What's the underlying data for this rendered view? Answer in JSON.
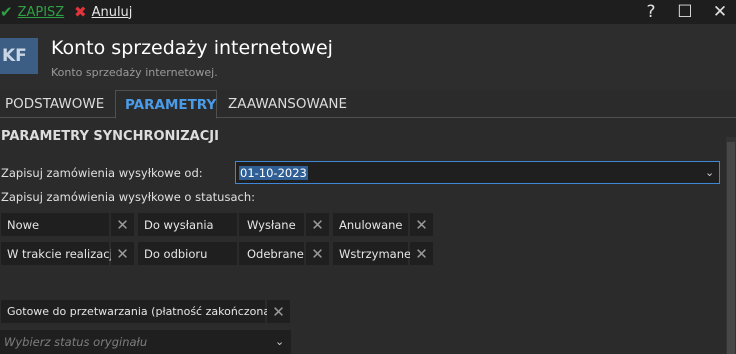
{
  "toolbar": {
    "save_label": "ZAPISZ",
    "cancel_label": "Anuluj",
    "save_color": "#2ea043",
    "cancel_color": "#e0343a",
    "help_glyph": "?",
    "maximize_glyph": "☐",
    "close_glyph": "✕"
  },
  "header": {
    "logo_text": "KF",
    "title": "Konto sprzedaży internetowej",
    "subtitle": "Konto sprzedaży internetowej.",
    "accent": "#3d5e84"
  },
  "tabs": [
    {
      "label": "PODSTAWOWE",
      "active": false
    },
    {
      "label": "PARAMETRY",
      "active": true
    },
    {
      "label": "ZAAWANSOWANE",
      "active": false
    }
  ],
  "section": {
    "title": "PARAMETRY SYNCHRONIZACJI"
  },
  "fields": {
    "orders_from_label": "Zapisuj zamówienia wysyłkowe od:",
    "orders_from_value": "01-10-2023",
    "statuses_label": "Zapisuj zamówienia wysyłkowe o statusach:"
  },
  "statuses": [
    {
      "label": "Nowe"
    },
    {
      "label": "Do wysłania"
    },
    {
      "label": "Wysłane"
    },
    {
      "label": "Anulowane"
    },
    {
      "label": "W trakcie realizacji"
    },
    {
      "label": "Do odbioru"
    },
    {
      "label": "Odebrane"
    },
    {
      "label": "Wstrzymane"
    }
  ],
  "mapped_status": {
    "label": "Gotowe do przetwarzania (płatność zakończona)",
    "select_placeholder": "Wybierz status oryginału"
  },
  "icons": {
    "save": "check-icon",
    "cancel": "x-icon",
    "remove": "close-icon",
    "dropdown": "chevron-down-icon"
  },
  "colors": {
    "active_tab": "#4b9ce8",
    "focus_border": "#3e87d6",
    "selection": "#2f5f95"
  }
}
